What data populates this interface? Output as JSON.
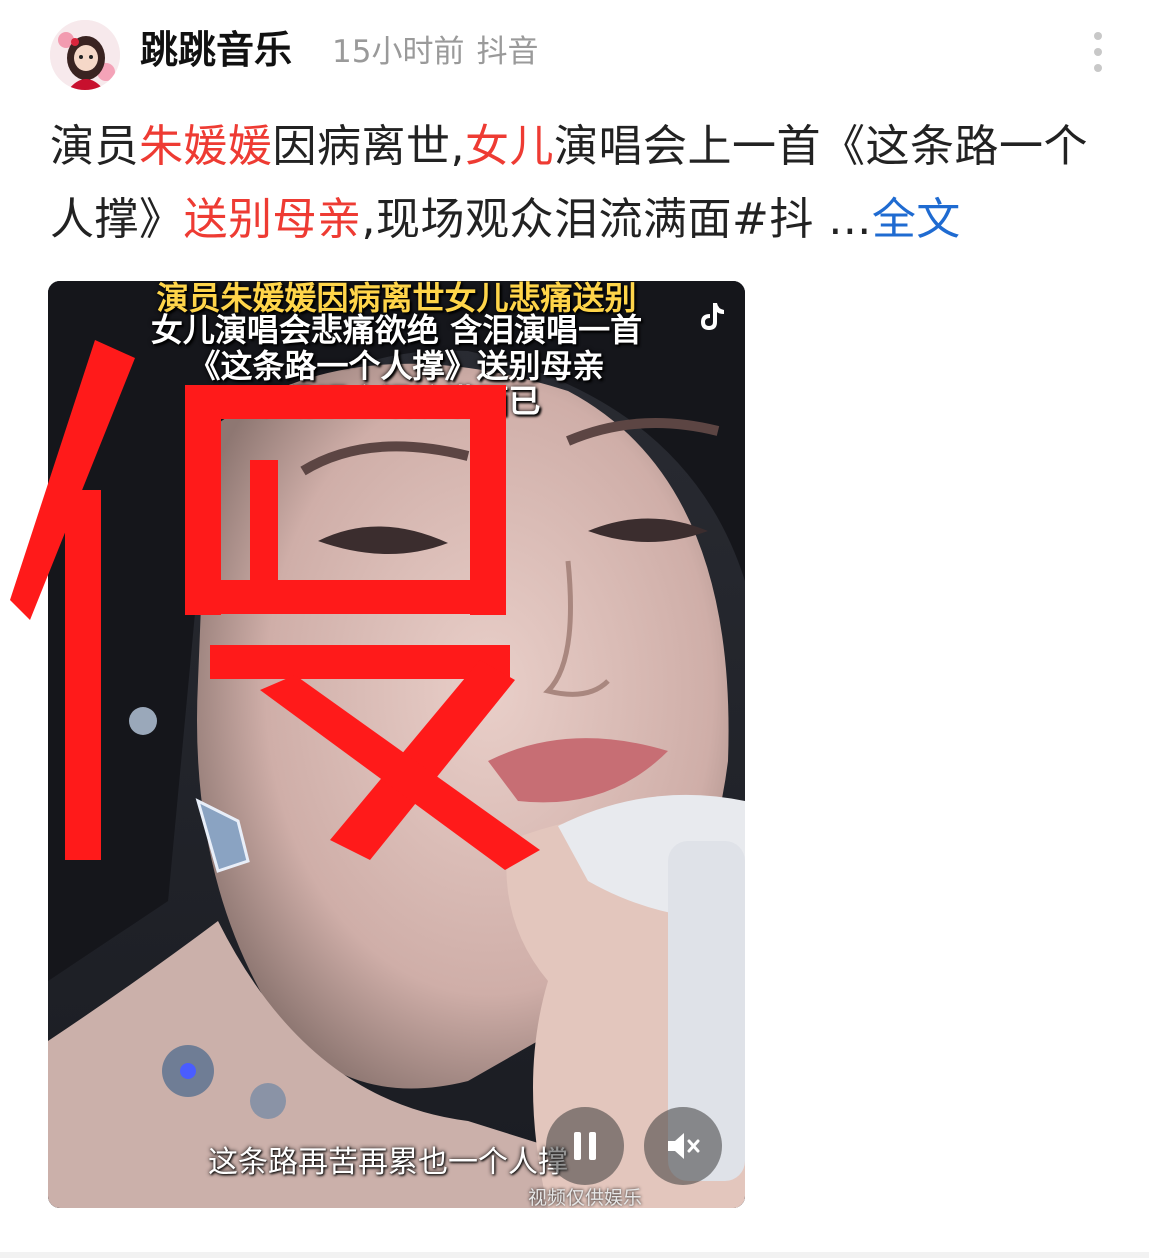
{
  "author": {
    "name": "跳跳音乐",
    "time": "15小时前",
    "source": "抖音"
  },
  "post": {
    "t1": "演员",
    "t2": "朱媛媛",
    "t3": "因病离世,",
    "t4": "女儿",
    "t5": "演唱会上一首《这条路一个人撑》",
    "t6": "送别母亲",
    "t7": ",现场观众泪流满面#抖 ...",
    "more": "全文"
  },
  "video": {
    "caption_line1": "演员朱媛媛因病离世女儿悲痛送别",
    "caption_line2": "女儿演唱会悲痛欲绝 含泪演唱一首",
    "caption_line3": "《这条路一个人撑》送别母亲",
    "caption_line4": "现场观众泪流满面已",
    "lyric": "这条路再苦再累也一个人撑",
    "watermark": "视频仅供娱乐",
    "stamp_text": "假"
  },
  "colors": {
    "highlight": "#ee3b33",
    "link": "#1f6bd1",
    "stamp": "#ff1a1a",
    "meta": "#9a9a9a"
  },
  "icons": [
    "avatar",
    "more-dots-icon",
    "tiktok-icon",
    "pause-icon",
    "mute-icon"
  ]
}
